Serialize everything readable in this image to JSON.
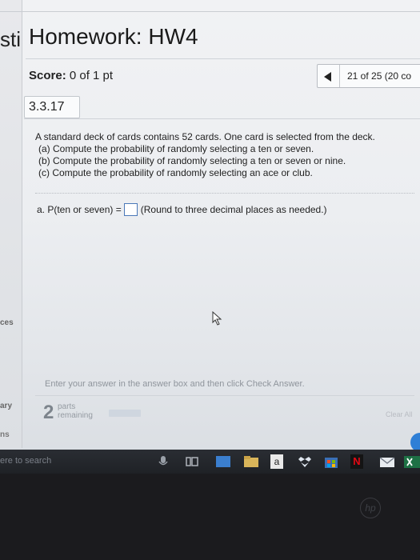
{
  "page": {
    "title": "Homework: HW4",
    "left_cut": {
      "top": "sti",
      "resources": "ces",
      "summary": "ary",
      "options": "ns"
    }
  },
  "score": {
    "label": "Score:",
    "value": "0 of 1 pt"
  },
  "navigation": {
    "position_text": "21 of 25 (20 co"
  },
  "question": {
    "number": "3.3.17",
    "lines": [
      "A standard deck of cards contains 52 cards. One card is selected from the deck.",
      "(a) Compute the probability of randomly selecting a ten or seven.",
      "(b) Compute the probability of randomly selecting a ten or seven or nine.",
      "(c) Compute the probability of randomly selecting an ace or club."
    ],
    "answer_prefix": "a. P(ten or seven) =",
    "answer_value": "",
    "answer_suffix": "(Round to three decimal places as needed.)"
  },
  "footer": {
    "hint": "Enter your answer in the answer box and then click Check Answer.",
    "parts_count": "2",
    "parts_label_1": "parts",
    "parts_label_2": "remaining",
    "progress_fraction": 0.0,
    "clear_all": "Clear All"
  },
  "taskbar": {
    "search_text": "ere to search",
    "app_letter": "a",
    "netflix_letter": "N"
  },
  "bezel": {
    "logo": "hp"
  },
  "colors": {
    "accent_blue": "#2f7fd6",
    "answer_box_border": "#4a78b8",
    "taskbar_bg": "#23262b"
  }
}
